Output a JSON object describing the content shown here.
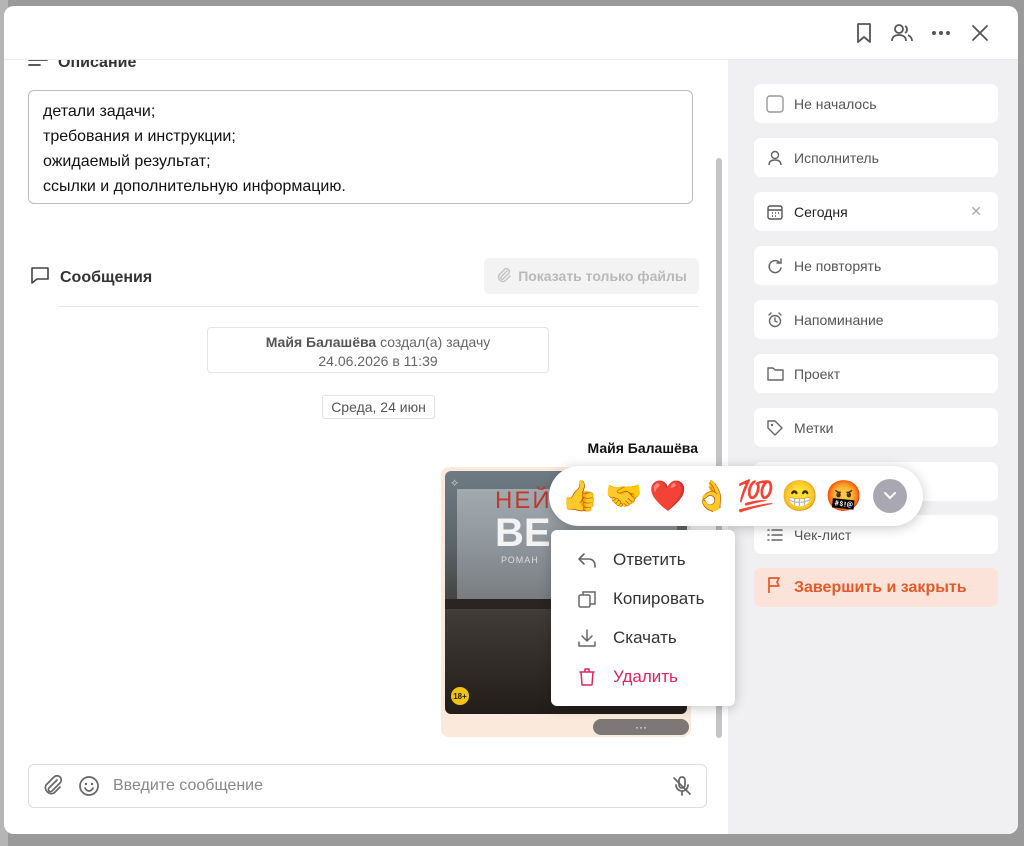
{
  "description": {
    "title": "Описание",
    "lines": [
      "детали задачи;",
      "требования и инструкции;",
      "ожидаемый результат;",
      "ссылки и дополнительную информацию."
    ]
  },
  "messages": {
    "title": "Сообщения",
    "files_only_label": "Показать только файлы",
    "system_author": "Майя Балашёва",
    "system_action": "создал(а) задачу",
    "system_date": "24.06.2026 в 11:39",
    "date_chip": "Среда, 24 июн",
    "author": "Майя Балашёва",
    "image_title_line1": "НЕЙТ",
    "image_title_line2": "ВЕ",
    "image_subtitle": "РОМАН",
    "image_age": "18+",
    "more_label": "···"
  },
  "emoji_bar": {
    "items": [
      "👍",
      "🤝",
      "❤️",
      "👌",
      "💯",
      "😁",
      "🤬"
    ]
  },
  "context_menu": {
    "reply": "Ответить",
    "copy": "Копировать",
    "download": "Скачать",
    "delete": "Удалить"
  },
  "input": {
    "placeholder": "Введите сообщение"
  },
  "sidebar": {
    "status": "Не началось",
    "assignee": "Исполнитель",
    "date": "Сегодня",
    "repeat": "Не повторять",
    "reminder": "Напоминание",
    "project": "Проект",
    "tags": "Метки",
    "checklist": "Чек-лист",
    "finish": "Завершить и закрыть"
  },
  "colors": {
    "accent": "#e05a2a",
    "danger": "#e0245e",
    "sidebar_bg": "#f0eff2"
  }
}
